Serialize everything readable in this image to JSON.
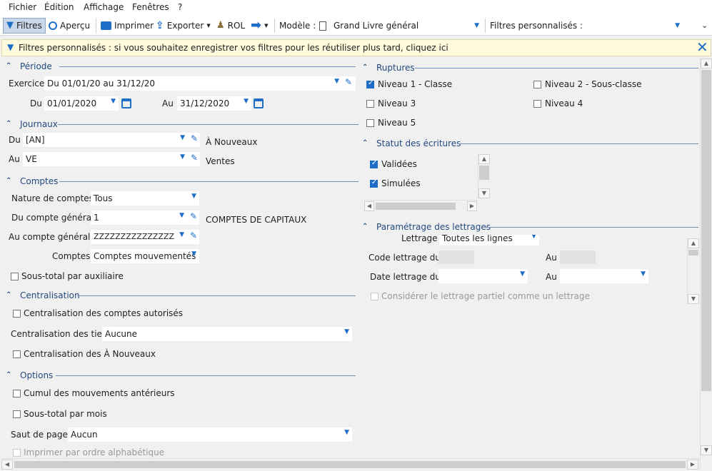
{
  "menu": [
    "Fichier",
    "Édition",
    "Affichage",
    "Fenêtres",
    "?"
  ],
  "toolbar": {
    "filtres": "Filtres",
    "apercu": "Aperçu",
    "imprimer": "Imprimer",
    "exporter": "Exporter",
    "rol": "ROL",
    "modele_label": "Modèle :",
    "modele_value": "Grand Livre général",
    "filtres_perso": "Filtres personnalisés :"
  },
  "info_bar": "Filtres personnalisés : si vous souhaitez enregistrer vos filtres pour les réutiliser plus tard, cliquez ici",
  "periode": {
    "title": "Période",
    "exercice_label": "Exercice",
    "exercice_value": "Du 01/01/20 au 31/12/20",
    "du_label": "Du",
    "du_value": "01/01/2020",
    "au_label": "Au",
    "au_value": "31/12/2020"
  },
  "journaux": {
    "title": "Journaux",
    "du_label": "Du",
    "du_value": "[AN]",
    "du_desc": "À Nouveaux",
    "au_label": "Au",
    "au_value": "VE",
    "au_desc": "Ventes"
  },
  "comptes": {
    "title": "Comptes",
    "nature_label": "Nature de comptes",
    "nature_value": "Tous",
    "du_label": "Du compte général",
    "du_value": "1",
    "du_desc": "COMPTES DE CAPITAUX",
    "au_label": "Au compte général",
    "au_value": "ZZZZZZZZZZZZZZZ",
    "comptes_label": "Comptes",
    "comptes_value": "Comptes mouvementés",
    "sous_total": "Sous-total par auxiliaire"
  },
  "centralisation": {
    "title": "Centralisation",
    "comptes_autorises": "Centralisation des comptes autorisés",
    "tiers_label": "Centralisation des tiers",
    "tiers_value": "Aucune",
    "a_nouveaux": "Centralisation des À Nouveaux"
  },
  "options": {
    "title": "Options",
    "cumul": "Cumul des mouvements antérieurs",
    "sous_total_mois": "Sous-total par mois",
    "saut_label": "Saut de page",
    "saut_value": "Aucun",
    "alpha": "Imprimer par ordre alphabétique"
  },
  "ruptures": {
    "title": "Ruptures",
    "n1": "Niveau 1 - Classe",
    "n2": "Niveau 2 - Sous-classe",
    "n3": "Niveau 3",
    "n4": "Niveau 4",
    "n5": "Niveau 5"
  },
  "statut": {
    "title": "Statut des écritures",
    "validees": "Validées",
    "simulees": "Simulées"
  },
  "lettrage": {
    "title": "Paramétrage des lettrages",
    "lettrage_label": "Lettrage",
    "lettrage_value": "Toutes les lignes",
    "code_label": "Code lettrage du",
    "code_au": "Au",
    "date_label": "Date lettrage du",
    "date_au": "Au",
    "partiel": "Considérer le lettrage partiel comme un lettrage"
  }
}
